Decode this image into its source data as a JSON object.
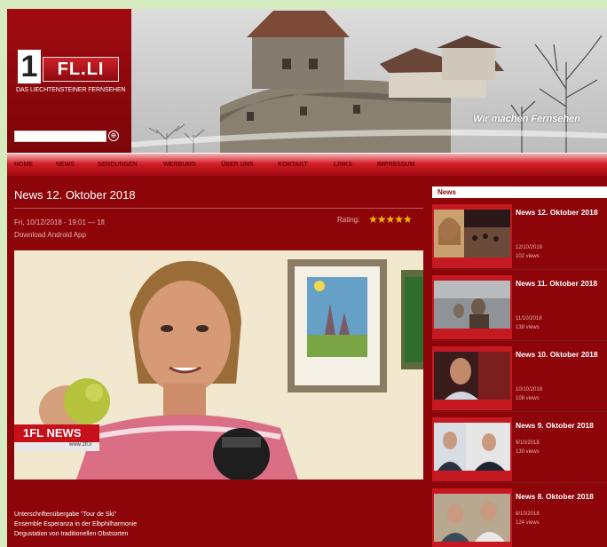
{
  "brand": {
    "logo_one": "1",
    "logo_fl": "FL.LI",
    "tagline": "DAS LIECHTENSTEINER FERNSEHEN",
    "slogan": "Wir machen Fernsehen"
  },
  "search": {
    "placeholder": "",
    "go_symbol": "⊕"
  },
  "nav": [
    "HOME",
    "NEWS",
    "SENDUNGEN",
    "WERBUNG",
    "ÜBER UNS",
    "KONTAKT",
    "LINKS",
    "IMPRESSUM"
  ],
  "article": {
    "title": "News 12. Oktober 2018",
    "meta": "Fri, 10/12/2018 - 19:01 — 1fl",
    "download": "Download Android App",
    "rating_label": "Rating:",
    "rating_stars": "★★★★★",
    "rating_value": 5,
    "video_logo": "1FL NEWS",
    "video_logo_sub": "www.1fl.li",
    "captions": [
      "Unterschriftenübergabe \"Tour de Ski\"",
      "Ensemble Esperanza in der Elbphilharmonie",
      "Degustation von traditionellen Obstsorten"
    ]
  },
  "sidebar": {
    "heading": "News",
    "items": [
      {
        "title": "News 12. Oktober 2018",
        "date": "12/10/2018",
        "views": "102 views"
      },
      {
        "title": "News 11. Oktober 2018",
        "date": "11/10/2018",
        "views": "138 views"
      },
      {
        "title": "News 10. Oktober 2018",
        "date": "10/10/2018",
        "views": "108 views"
      },
      {
        "title": "News 9. Oktober 2018",
        "date": "9/10/2018",
        "views": "130 views"
      },
      {
        "title": "News 8. Oktober 2018",
        "date": "8/10/2018",
        "views": "124 views"
      }
    ]
  },
  "colors": {
    "brand_red": "#8e0509",
    "nav_red": "#d21e27",
    "star": "#f5b800"
  }
}
